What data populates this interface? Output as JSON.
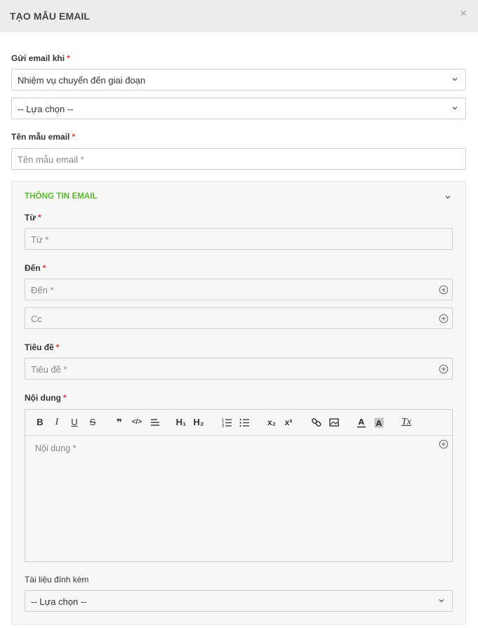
{
  "dialog": {
    "title": "TẠO MẪU EMAIL",
    "close": "×"
  },
  "trigger": {
    "label": "Gửi email khi",
    "required": "*",
    "event_value": "Nhiệm vụ chuyển đến giai đoạn",
    "stage_value": "-- Lựa chọn --"
  },
  "template_name": {
    "label": "Tên mẫu email",
    "required": "*",
    "placeholder": "Tên mẫu email *"
  },
  "email_info": {
    "title": "THÔNG TIN EMAIL",
    "from": {
      "label": "Từ",
      "required": "*",
      "placeholder": "Từ *"
    },
    "to": {
      "label": "Đến",
      "required": "*",
      "placeholder": "Đến *"
    },
    "cc": {
      "placeholder": "Cc"
    },
    "subject": {
      "label": "Tiêu đề",
      "required": "*",
      "placeholder": "Tiêu đề *"
    },
    "content": {
      "label": "Nội dung",
      "required": "*",
      "placeholder": "Nội dung *",
      "toolbar": {
        "bold": "B",
        "italic": "I",
        "underline": "U",
        "strike": "S",
        "quote": "❞",
        "code": "</>",
        "h1": "H₁",
        "h2": "H₂",
        "subscript": "x₂",
        "superscript": "x²",
        "clear": "Tx"
      }
    },
    "attachments": {
      "label": "Tài liệu đính kèm",
      "value": "-- Lựa chọn --"
    }
  },
  "colors": {
    "accent": "#5cb82e",
    "required": "#e23a3a",
    "header_bg": "#ebebeb",
    "panel_bg": "#f7f7f7"
  }
}
